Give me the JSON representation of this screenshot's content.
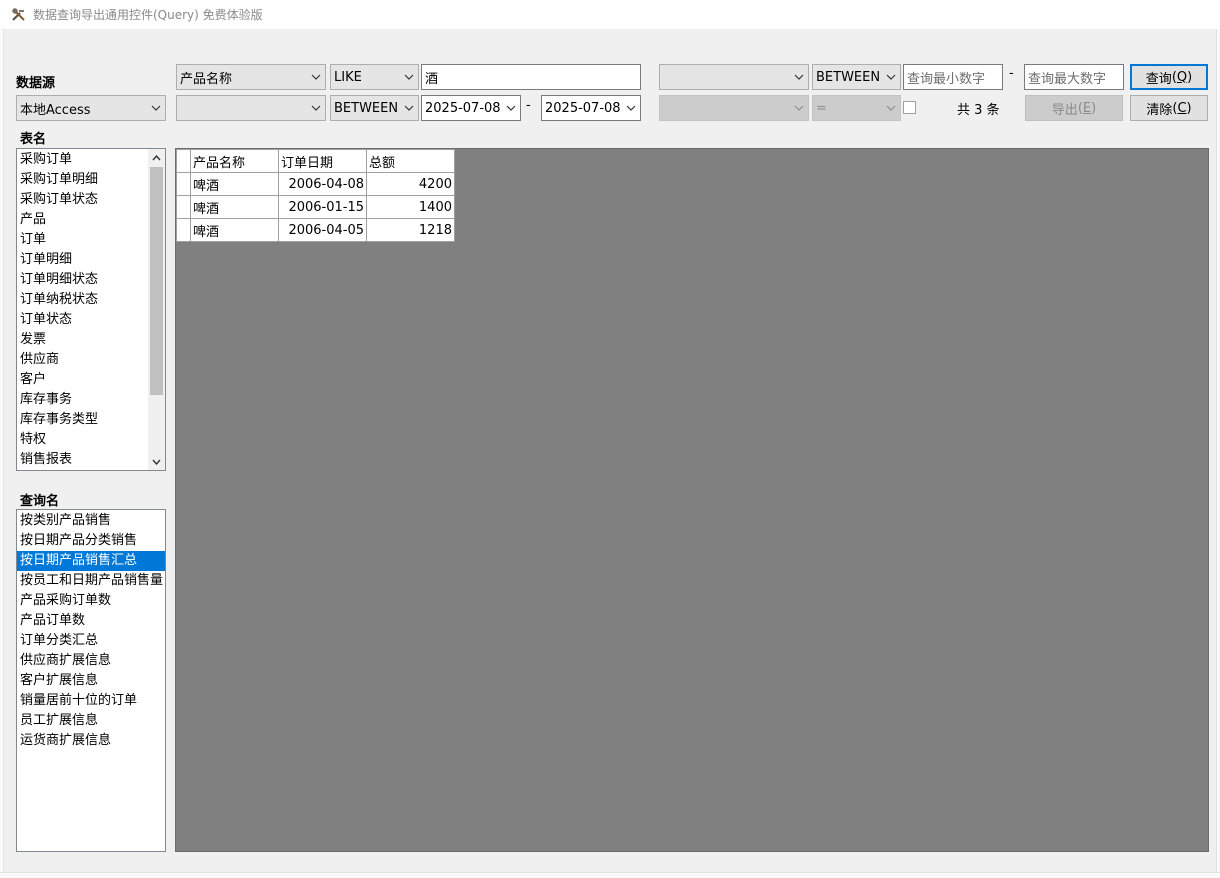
{
  "window": {
    "title": "数据查询导出通用控件(Query) 免费体验版"
  },
  "datasource": {
    "label": "数据源",
    "selected": "本地Access"
  },
  "tables": {
    "label": "表名",
    "items": [
      "采购订单",
      "采购订单明细",
      "采购订单状态",
      "产品",
      "订单",
      "订单明细",
      "订单明细状态",
      "订单纳税状态",
      "订单状态",
      "发票",
      "供应商",
      "客户",
      "库存事务",
      "库存事务类型",
      "特权",
      "销售报表"
    ]
  },
  "queries": {
    "label": "查询名",
    "items": [
      "按类别产品销售",
      "按日期产品分类销售",
      "按日期产品销售汇总",
      "按员工和日期产品销售量",
      "产品采购订单数",
      "产品订单数",
      "订单分类汇总",
      "供应商扩展信息",
      "客户扩展信息",
      "销量居前十位的订单",
      "员工扩展信息",
      "运货商扩展信息"
    ],
    "selected_index": 2
  },
  "filters": {
    "row1": {
      "field": "产品名称",
      "operator": "LIKE",
      "value": "酒"
    },
    "row2": {
      "field": "",
      "operator": "BETWEEN",
      "date_from": "2025-07-08",
      "separator": "-",
      "date_to": "2025-07-08"
    },
    "right_row1": {
      "field": "",
      "operator": "BETWEEN",
      "min_placeholder": "查询最小数字",
      "separator": "-",
      "max_placeholder": "查询最大数字"
    },
    "right_row2": {
      "field": "",
      "operator": "="
    }
  },
  "actions": {
    "query_label": "查询",
    "query_key": "Q",
    "export_label": "导出",
    "export_key": "E",
    "clear_label": "清除",
    "clear_key": "C"
  },
  "result": {
    "count_text": "共 3 条"
  },
  "grid": {
    "columns": [
      "产品名称",
      "订单日期",
      "总额"
    ],
    "rows": [
      [
        "啤酒",
        "2006-04-08",
        "4200"
      ],
      [
        "啤酒",
        "2006-01-15",
        "1400"
      ],
      [
        "啤酒",
        "2006-04-05",
        "1218"
      ]
    ]
  }
}
